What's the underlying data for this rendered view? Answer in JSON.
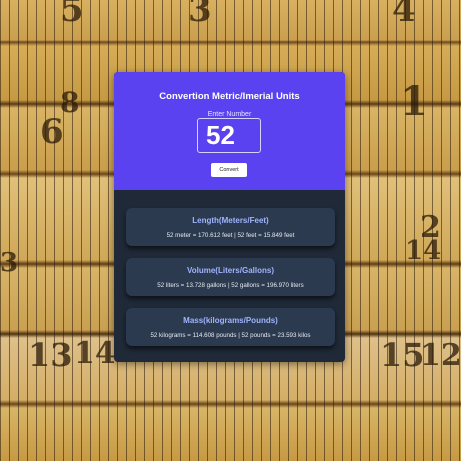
{
  "app": {
    "title": "Convertion Metric/Imerial Units",
    "input_label": "Enter Number",
    "input_value": "52",
    "convert_label": "Convert",
    "accent_color": "#5a42f0",
    "panel_color": "#1f2937"
  },
  "results": [
    {
      "title": "Length(Meters/Feet)",
      "text": "52 meter = 170.612 feet | 52 feet = 15.849 feet"
    },
    {
      "title": "Volume(Liters/Gallons)",
      "text": "52 liters = 13.728 gallons | 52 gallons = 196.970 liters"
    },
    {
      "title": "Mass(kilograms/Pounds)",
      "text": "52 kilograms = 114.608 pounds | 52 pounds = 23.593 kilos"
    }
  ],
  "background": {
    "description_icon": "tape-measure-background",
    "visible_numbers": [
      "5",
      "3",
      "4",
      "1",
      "6",
      "8",
      "2",
      "14",
      "3",
      "13",
      "14",
      "15",
      "12"
    ]
  }
}
